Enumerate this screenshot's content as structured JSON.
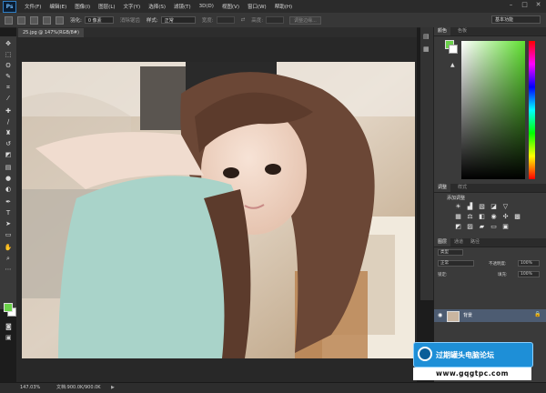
{
  "app": {
    "logo": "Ps"
  },
  "menu": [
    "文件(F)",
    "编辑(E)",
    "图像(I)",
    "图层(L)",
    "文字(Y)",
    "选择(S)",
    "滤镜(T)",
    "3D(D)",
    "视图(V)",
    "窗口(W)",
    "帮助(H)"
  ],
  "options": {
    "feather_label": "羽化:",
    "feather_value": "0 像素",
    "antialias": "消除锯齿",
    "style_label": "样式:",
    "style_value": "正常",
    "width_label": "宽度:",
    "height_label": "高度:",
    "refine_edge": "调整边缘..."
  },
  "workspace": "基本功能",
  "document": {
    "tab": "25.jpg @ 147%(RGB/8#)",
    "zoom": "147.03%",
    "doc_info": "文档:900.0K/900.0K"
  },
  "panels": {
    "color_tabs": [
      "颜色",
      "色板"
    ],
    "adjust_tabs": [
      "调整",
      "样式"
    ],
    "adjust_title": "添加调整",
    "layer_tabs": [
      "图层",
      "通道",
      "路径"
    ],
    "layer_kind": "类型",
    "blend_mode": "正常",
    "opacity_label": "不透明度:",
    "opacity_value": "100%",
    "lock_label": "锁定:",
    "fill_label": "填充:",
    "fill_value": "100%",
    "layer_name": "背景"
  },
  "watermark": {
    "title": "过期罐头电脑论坛",
    "url": "www.gqgtpc.com"
  },
  "colors": {
    "foreground": "#6bd24a",
    "background": "#ffffff",
    "accent": "#1e8fd7"
  }
}
